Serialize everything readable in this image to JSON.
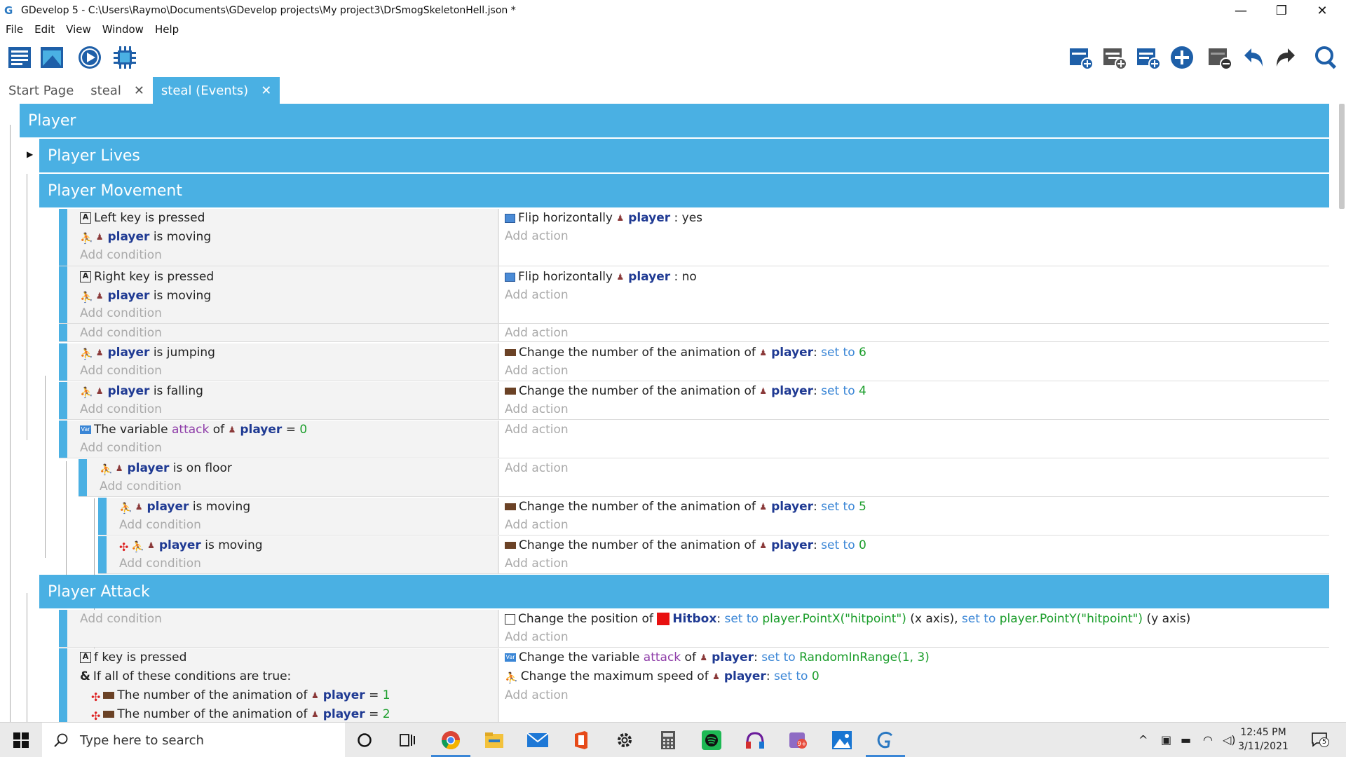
{
  "window": {
    "title": "GDevelop 5 - C:\\Users\\Raymo\\Documents\\GDevelop projects\\My project3\\DrSmogSkeletonHell.json *",
    "minimize": "—",
    "maximize": "❐",
    "close": "✕"
  },
  "menu": [
    "File",
    "Edit",
    "View",
    "Window",
    "Help"
  ],
  "tabs": [
    {
      "label": "Start Page"
    },
    {
      "label": "steal",
      "close": "✕"
    },
    {
      "label": "steal (Events)",
      "close": "✕"
    }
  ],
  "groups": {
    "player": "Player",
    "lives": "Player Lives",
    "movement": "Player Movement",
    "attack": "Player Attack"
  },
  "text": {
    "add_condition": "Add condition",
    "add_action": "Add action",
    "player": "player",
    "key_A": "A",
    "left_key": "Left",
    "right_key": "Right",
    "f_key": "f",
    "key_pressed": "key is pressed",
    "is_moving": "is moving",
    "is_jumping": "is jumping",
    "is_falling": "is falling",
    "is_on_floor": "is on floor",
    "flip_horizontally": "Flip horizontally",
    "yes": ": yes",
    "no": ": no",
    "change_anim": "Change the number of the animation of",
    "set_to": "set to",
    "colon": ":",
    "the_variable": "The variable",
    "attack": "attack",
    "of": "of",
    "equals": "=",
    "zero": "0",
    "one": "1",
    "two": "2",
    "three": "3",
    "four": "4",
    "five": "5",
    "six": "6",
    "change_position": "Change the position of",
    "hitbox": "Hitbox",
    "pointx": "player.PointX(\"hitpoint\")",
    "x_axis": "(x axis),",
    "pointy": "player.PointY(\"hitpoint\")",
    "y_axis": "(y axis)",
    "change_variable": "Change the variable",
    "random": "RandomInRange(1, 3)",
    "change_max_speed": "Change the maximum speed of",
    "if_all": "If all of these conditions are true:",
    "and_symbol": "&",
    "anim_number": "The number of the animation of"
  },
  "taskbar": {
    "search_placeholder": "Type here to search",
    "time": "12:45 PM",
    "date": "3/11/2021",
    "notif_count": "5"
  },
  "icons": {
    "move": "⛹",
    "player": "♟",
    "invert": "✣"
  }
}
